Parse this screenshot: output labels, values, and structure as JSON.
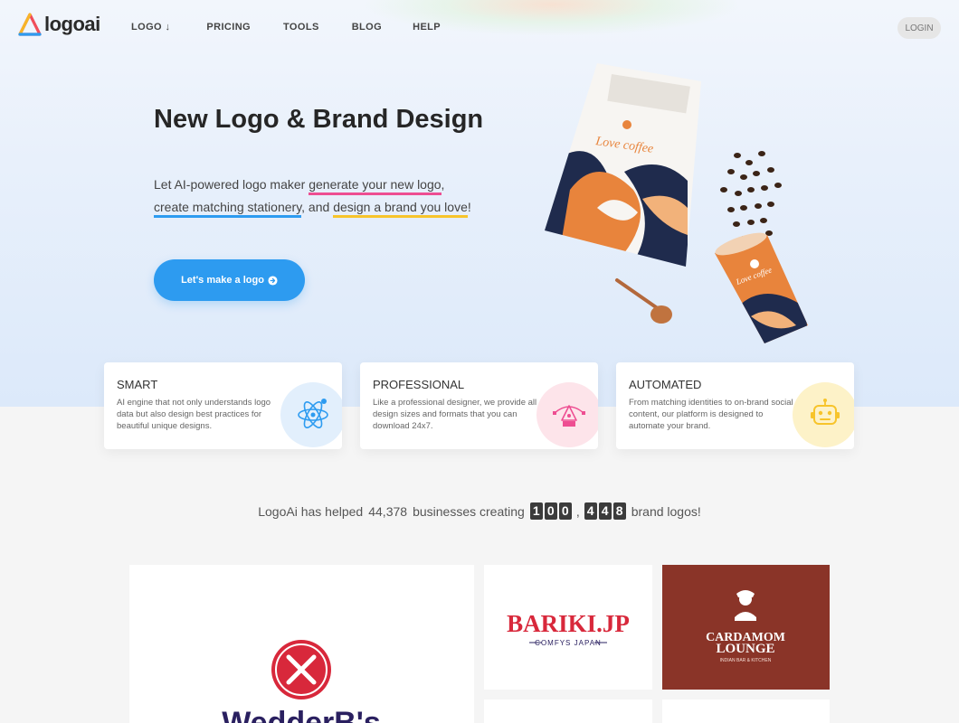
{
  "brand": {
    "name": "logoai"
  },
  "nav": {
    "items": [
      "LOGO ↓",
      "PRICING",
      "TOOLS",
      "BLOG",
      "HELP"
    ],
    "login": "LOGIN"
  },
  "hero": {
    "title": "New Logo & Brand Design",
    "desc_1": "Let AI-powered logo maker ",
    "desc_hl_1": "generate your new logo",
    "desc_2": ",",
    "desc_hl_2": "create matching stationery",
    "desc_3": ", and ",
    "desc_hl_3": "design a brand you love",
    "desc_4": "!",
    "cta": "Let's make a logo",
    "product_bag_tagline": "Love coffee",
    "product_cup_tagline": "Love coffee"
  },
  "features": [
    {
      "title": "SMART",
      "text": "AI engine that not only understands logo data but also design best practices for beautiful unique designs.",
      "icon": "atom-icon"
    },
    {
      "title": "PROFESSIONAL",
      "text": "Like a professional designer, we provide all design sizes and formats that you can download 24x7.",
      "icon": "pen-tool-icon"
    },
    {
      "title": "AUTOMATED",
      "text": "From matching identities to on-brand social content, our platform is designed to automate your brand.",
      "icon": "robot-icon"
    }
  ],
  "stats": {
    "prefix": "LogoAi has helped",
    "businesses": "44,378",
    "middle": "businesses creating",
    "digits_a": [
      "1",
      "0",
      "0"
    ],
    "digits_b": [
      "4",
      "4",
      "8"
    ],
    "suffix": "brand logos!"
  },
  "showcase": {
    "wedder": "WedderB's",
    "bariki_main": "BARIKI.JP",
    "bariki_sub": "COMFYS JAPAN",
    "cardamom_1": "CARDAMOM",
    "cardamom_2": "LOUNGE",
    "cardamom_sub": "INDIAN BAR & KITCHEN"
  },
  "colors": {
    "accent": "#2d9bf0",
    "pink": "#ee4e92",
    "yellow": "#f7c42b",
    "cardamom_bg": "#8a3428",
    "bariki_red": "#d8283b",
    "wedder_navy": "#2a2060"
  }
}
